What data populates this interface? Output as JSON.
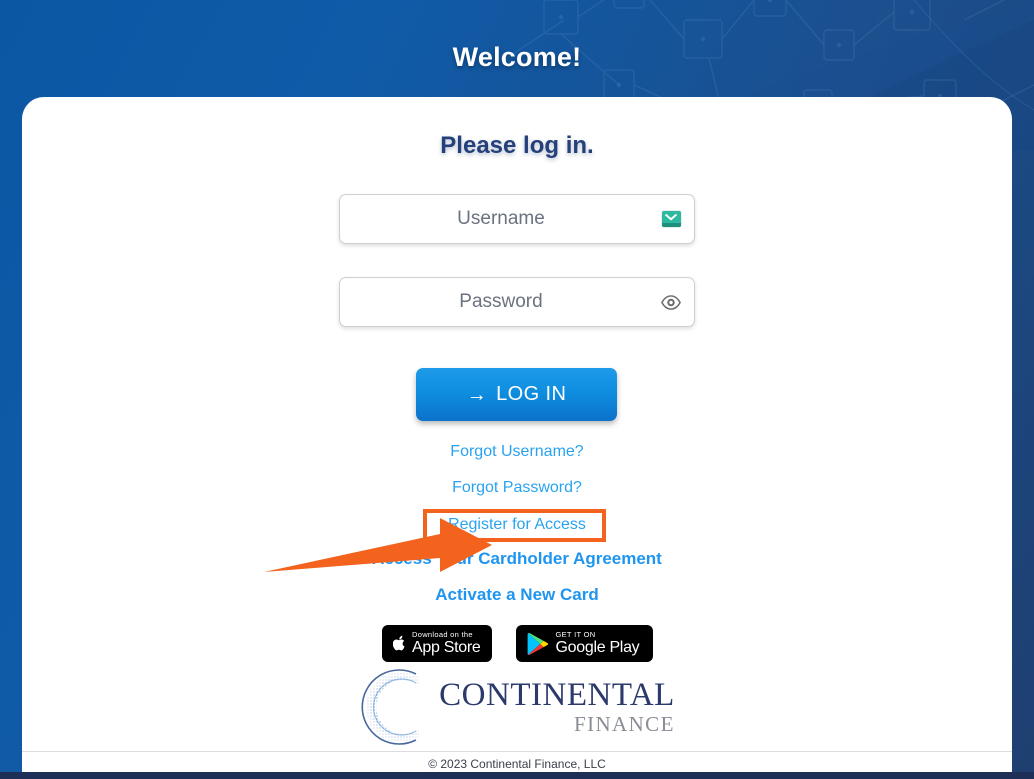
{
  "header": {
    "welcome_title": "Welcome!"
  },
  "card": {
    "heading": "Please log in."
  },
  "form": {
    "username": {
      "placeholder": "Username",
      "value": "",
      "icon": "autofill-envelope-icon"
    },
    "password": {
      "placeholder": "Password",
      "value": "",
      "icon": "eye-icon"
    },
    "submit": {
      "label": "LOG IN",
      "arrow_glyph": "→"
    }
  },
  "links": {
    "forgot_username": "Forgot Username?",
    "forgot_password": "Forgot Password?",
    "register": "Register for Access",
    "cardholder_agreement": "Access Your Cardholder Agreement",
    "activate_card": "Activate a New Card"
  },
  "annotation": {
    "highlight_target": "Register for Access",
    "shape": "arrow-pointing-right",
    "color": "#f4631e"
  },
  "store_badges": {
    "apple": {
      "top_line": "Download on the",
      "main_line": "App Store",
      "icon": "apple-logo-icon"
    },
    "google": {
      "top_line": "GET IT ON",
      "main_line": "Google Play",
      "icon": "google-play-triangle-icon"
    }
  },
  "logo": {
    "name": "CONTINENTAL",
    "subtitle": "FINANCE",
    "mark": "globe-sphere-icon"
  },
  "footer": {
    "copyright": "© 2023 Continental Finance, LLC"
  },
  "colors": {
    "header_blue": "#0f5ba8",
    "heading_navy": "#25417a",
    "link_blue": "#29a3f0",
    "button_blue": "#0f8ee0",
    "annotation_orange": "#f4631e",
    "bottom_bar_navy": "#1d2f57"
  }
}
